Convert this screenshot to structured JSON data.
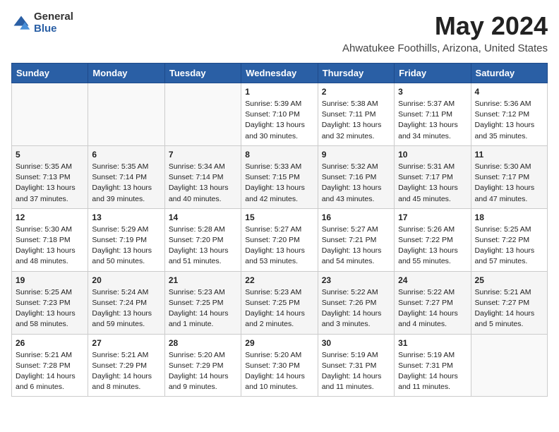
{
  "logo": {
    "general": "General",
    "blue": "Blue"
  },
  "title": {
    "month_year": "May 2024",
    "location": "Ahwatukee Foothills, Arizona, United States"
  },
  "days_of_week": [
    "Sunday",
    "Monday",
    "Tuesday",
    "Wednesday",
    "Thursday",
    "Friday",
    "Saturday"
  ],
  "weeks": [
    [
      {
        "day": "",
        "info": ""
      },
      {
        "day": "",
        "info": ""
      },
      {
        "day": "",
        "info": ""
      },
      {
        "day": "1",
        "info": "Sunrise: 5:39 AM\nSunset: 7:10 PM\nDaylight: 13 hours\nand 30 minutes."
      },
      {
        "day": "2",
        "info": "Sunrise: 5:38 AM\nSunset: 7:11 PM\nDaylight: 13 hours\nand 32 minutes."
      },
      {
        "day": "3",
        "info": "Sunrise: 5:37 AM\nSunset: 7:11 PM\nDaylight: 13 hours\nand 34 minutes."
      },
      {
        "day": "4",
        "info": "Sunrise: 5:36 AM\nSunset: 7:12 PM\nDaylight: 13 hours\nand 35 minutes."
      }
    ],
    [
      {
        "day": "5",
        "info": "Sunrise: 5:35 AM\nSunset: 7:13 PM\nDaylight: 13 hours\nand 37 minutes."
      },
      {
        "day": "6",
        "info": "Sunrise: 5:35 AM\nSunset: 7:14 PM\nDaylight: 13 hours\nand 39 minutes."
      },
      {
        "day": "7",
        "info": "Sunrise: 5:34 AM\nSunset: 7:14 PM\nDaylight: 13 hours\nand 40 minutes."
      },
      {
        "day": "8",
        "info": "Sunrise: 5:33 AM\nSunset: 7:15 PM\nDaylight: 13 hours\nand 42 minutes."
      },
      {
        "day": "9",
        "info": "Sunrise: 5:32 AM\nSunset: 7:16 PM\nDaylight: 13 hours\nand 43 minutes."
      },
      {
        "day": "10",
        "info": "Sunrise: 5:31 AM\nSunset: 7:17 PM\nDaylight: 13 hours\nand 45 minutes."
      },
      {
        "day": "11",
        "info": "Sunrise: 5:30 AM\nSunset: 7:17 PM\nDaylight: 13 hours\nand 47 minutes."
      }
    ],
    [
      {
        "day": "12",
        "info": "Sunrise: 5:30 AM\nSunset: 7:18 PM\nDaylight: 13 hours\nand 48 minutes."
      },
      {
        "day": "13",
        "info": "Sunrise: 5:29 AM\nSunset: 7:19 PM\nDaylight: 13 hours\nand 50 minutes."
      },
      {
        "day": "14",
        "info": "Sunrise: 5:28 AM\nSunset: 7:20 PM\nDaylight: 13 hours\nand 51 minutes."
      },
      {
        "day": "15",
        "info": "Sunrise: 5:27 AM\nSunset: 7:20 PM\nDaylight: 13 hours\nand 53 minutes."
      },
      {
        "day": "16",
        "info": "Sunrise: 5:27 AM\nSunset: 7:21 PM\nDaylight: 13 hours\nand 54 minutes."
      },
      {
        "day": "17",
        "info": "Sunrise: 5:26 AM\nSunset: 7:22 PM\nDaylight: 13 hours\nand 55 minutes."
      },
      {
        "day": "18",
        "info": "Sunrise: 5:25 AM\nSunset: 7:22 PM\nDaylight: 13 hours\nand 57 minutes."
      }
    ],
    [
      {
        "day": "19",
        "info": "Sunrise: 5:25 AM\nSunset: 7:23 PM\nDaylight: 13 hours\nand 58 minutes."
      },
      {
        "day": "20",
        "info": "Sunrise: 5:24 AM\nSunset: 7:24 PM\nDaylight: 13 hours\nand 59 minutes."
      },
      {
        "day": "21",
        "info": "Sunrise: 5:23 AM\nSunset: 7:25 PM\nDaylight: 14 hours\nand 1 minute."
      },
      {
        "day": "22",
        "info": "Sunrise: 5:23 AM\nSunset: 7:25 PM\nDaylight: 14 hours\nand 2 minutes."
      },
      {
        "day": "23",
        "info": "Sunrise: 5:22 AM\nSunset: 7:26 PM\nDaylight: 14 hours\nand 3 minutes."
      },
      {
        "day": "24",
        "info": "Sunrise: 5:22 AM\nSunset: 7:27 PM\nDaylight: 14 hours\nand 4 minutes."
      },
      {
        "day": "25",
        "info": "Sunrise: 5:21 AM\nSunset: 7:27 PM\nDaylight: 14 hours\nand 5 minutes."
      }
    ],
    [
      {
        "day": "26",
        "info": "Sunrise: 5:21 AM\nSunset: 7:28 PM\nDaylight: 14 hours\nand 6 minutes."
      },
      {
        "day": "27",
        "info": "Sunrise: 5:21 AM\nSunset: 7:29 PM\nDaylight: 14 hours\nand 8 minutes."
      },
      {
        "day": "28",
        "info": "Sunrise: 5:20 AM\nSunset: 7:29 PM\nDaylight: 14 hours\nand 9 minutes."
      },
      {
        "day": "29",
        "info": "Sunrise: 5:20 AM\nSunset: 7:30 PM\nDaylight: 14 hours\nand 10 minutes."
      },
      {
        "day": "30",
        "info": "Sunrise: 5:19 AM\nSunset: 7:31 PM\nDaylight: 14 hours\nand 11 minutes."
      },
      {
        "day": "31",
        "info": "Sunrise: 5:19 AM\nSunset: 7:31 PM\nDaylight: 14 hours\nand 11 minutes."
      },
      {
        "day": "",
        "info": ""
      }
    ]
  ]
}
